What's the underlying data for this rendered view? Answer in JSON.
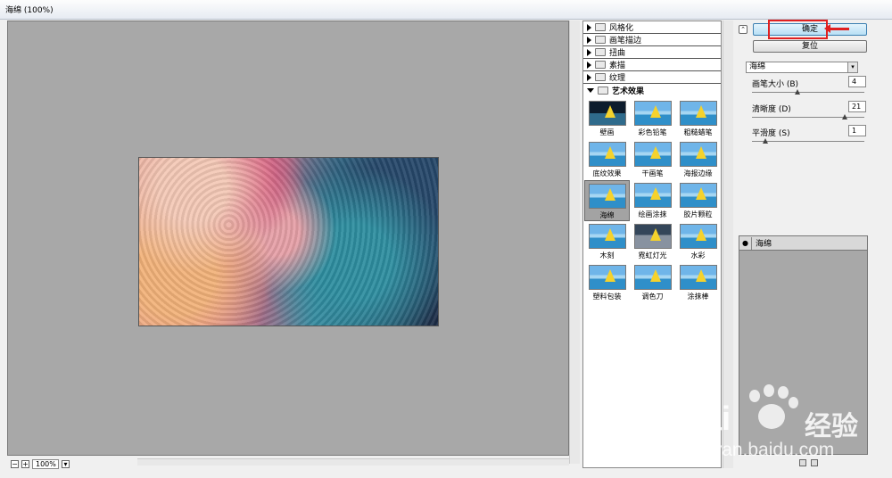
{
  "window": {
    "title": "海绵 (100%)"
  },
  "preview": {
    "zoom_value": "100%",
    "zoom_minus": "−",
    "zoom_plus": "+"
  },
  "gallery": {
    "categories": [
      {
        "label": "风格化"
      },
      {
        "label": "画笔描边"
      },
      {
        "label": "扭曲"
      },
      {
        "label": "素描"
      },
      {
        "label": "纹理"
      }
    ],
    "open_category": {
      "label": "艺术效果"
    },
    "filters": [
      {
        "label": "壁画",
        "style": "dark"
      },
      {
        "label": "彩色铅笔",
        "style": "normal"
      },
      {
        "label": "粗糙蜡笔",
        "style": "normal"
      },
      {
        "label": "底纹效果",
        "style": "normal"
      },
      {
        "label": "干画笔",
        "style": "normal"
      },
      {
        "label": "海报边缘",
        "style": "normal"
      },
      {
        "label": "海绵",
        "style": "normal",
        "selected": true
      },
      {
        "label": "绘画涂抹",
        "style": "normal"
      },
      {
        "label": "胶片颗粒",
        "style": "normal"
      },
      {
        "label": "木刻",
        "style": "normal"
      },
      {
        "label": "霓虹灯光",
        "style": "night"
      },
      {
        "label": "水彩",
        "style": "normal"
      },
      {
        "label": "塑料包装",
        "style": "normal"
      },
      {
        "label": "调色刀",
        "style": "normal"
      },
      {
        "label": "涂抹棒",
        "style": "normal"
      }
    ]
  },
  "controls": {
    "collapse_symbol": "⌃",
    "ok_label": "确定",
    "reset_label": "复位",
    "filter_select": "海绵",
    "params": [
      {
        "label": "画笔大小 (B)",
        "value": "4",
        "fraction": 0.4
      },
      {
        "label": "清晰度 (D)",
        "value": "21",
        "fraction": 0.84
      },
      {
        "label": "平滑度 (S)",
        "value": "1",
        "fraction": 0.1
      }
    ]
  },
  "layers": {
    "layer_name": "海绵",
    "eye_symbol": "●"
  },
  "watermark": {
    "brand": "Bai",
    "brand_cn": "经验",
    "url": "jingyan.baidu.com"
  }
}
